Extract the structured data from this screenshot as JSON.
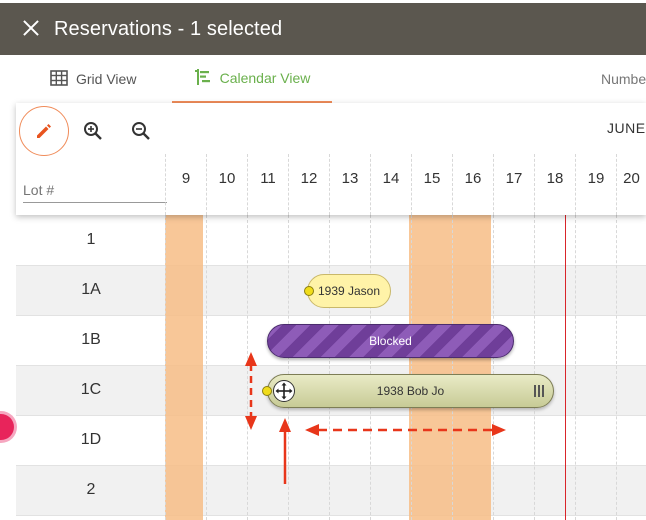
{
  "header": {
    "title": "Reservations  - 1 selected",
    "close_icon": "close-icon"
  },
  "tabs": [
    {
      "label": "Grid View",
      "icon": "grid-icon",
      "active": false
    },
    {
      "label": "Calendar View",
      "icon": "calendar-view-icon",
      "active": true
    },
    {
      "label": "Numbe",
      "active": false
    }
  ],
  "toolbar": {
    "edit_icon": "pencil-icon",
    "zoom_in_icon": "zoom-in-icon",
    "zoom_out_icon": "zoom-out-icon",
    "month": "JUNE",
    "lot_placeholder": "Lot #"
  },
  "days": [
    "9",
    "10",
    "11",
    "12",
    "13",
    "14",
    "15",
    "16",
    "17",
    "18",
    "19",
    "20"
  ],
  "lots": [
    "1",
    "1A",
    "1B",
    "1C",
    "1D",
    "2"
  ],
  "reservations": [
    {
      "label": "1939 Jason",
      "color": "#fff3a8"
    },
    {
      "label": "Blocked",
      "color": "#8e5cb8"
    },
    {
      "label": "1938 Bob Jo",
      "color": "#d9dcab"
    }
  ],
  "colors": {
    "header_bg": "#5b574f",
    "accent_green": "#6ab04c",
    "accent_orange": "#f08c5a",
    "highlight_col": "#f7bd86",
    "today_line": "#d9252a",
    "arrow": "#e8361a"
  }
}
